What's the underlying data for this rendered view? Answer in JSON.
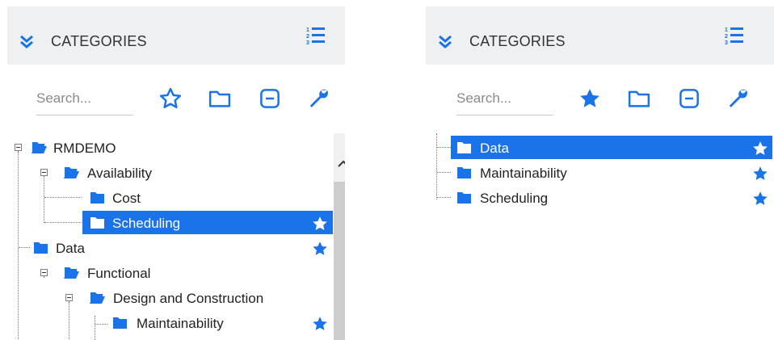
{
  "colors": {
    "accent": "#1a73e8",
    "icon_blue": "#1a73e8",
    "header_bg": "#eef0f2",
    "selection_bg": "#1a73e8"
  },
  "left_panel": {
    "header": {
      "title": "CATEGORIES",
      "collapse_icon": "double-chevron-down-icon",
      "list_icon": "numbered-list-icon"
    },
    "search": {
      "placeholder": "Search...",
      "value": ""
    },
    "toolbar": {
      "favorites_icon": "star-outline-icon",
      "folder_icon": "folder-outline-icon",
      "collapse_all_icon": "minus-square-icon",
      "settings_icon": "wrench-icon"
    },
    "tree": {
      "rmdemo": "RMDEMO",
      "availability": "Availability",
      "cost": "Cost",
      "scheduling": "Scheduling",
      "data": "Data",
      "functional": "Functional",
      "design_construction": "Design and Construction",
      "maintainability": "Maintainability"
    }
  },
  "right_panel": {
    "header": {
      "title": "CATEGORIES",
      "collapse_icon": "double-chevron-down-icon",
      "list_icon": "numbered-list-icon"
    },
    "search": {
      "placeholder": "Search...",
      "value": ""
    },
    "toolbar": {
      "favorites_icon": "star-filled-icon",
      "folder_icon": "folder-outline-icon",
      "collapse_all_icon": "minus-square-icon",
      "settings_icon": "wrench-icon"
    },
    "tree": {
      "data": "Data",
      "maintainability": "Maintainability",
      "scheduling": "Scheduling"
    }
  }
}
